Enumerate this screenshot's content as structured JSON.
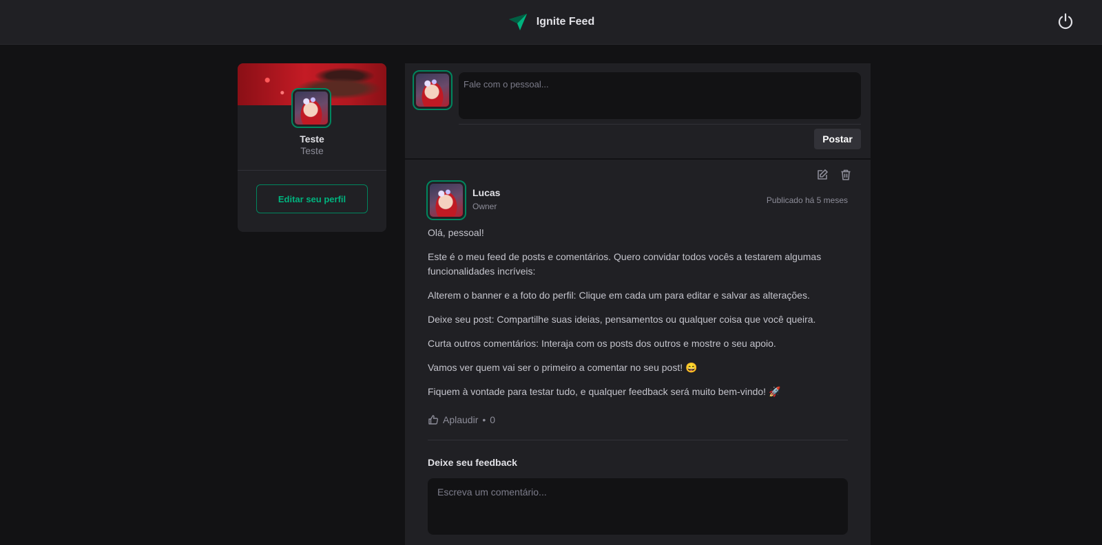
{
  "header": {
    "app_title": "Ignite Feed",
    "logo_icon": "paper-plane-icon",
    "logout_icon": "power-icon"
  },
  "sidebar": {
    "name": "Teste",
    "role": "Teste",
    "edit_label": "Editar seu perfil"
  },
  "composer": {
    "placeholder": "Fale com o pessoal...",
    "post_label": "Postar"
  },
  "post": {
    "author_name": "Lucas",
    "author_role": "Owner",
    "published": "Publicado há 5 meses",
    "paragraphs": [
      "Olá, pessoal!",
      "Este é o meu feed de posts e comentários. Quero convidar todos vocês a testarem algumas funcionalidades incríveis:",
      "Alterem o banner e a foto do perfil: Clique em cada um para editar e salvar as alterações.",
      "Deixe seu post: Compartilhe suas ideias, pensamentos ou qualquer coisa que você queira.",
      "Curta outros comentários: Interaja com os posts dos outros e mostre o seu apoio.",
      "Vamos ver quem vai ser o primeiro a comentar no seu post! 😄",
      "Fiquem à vontade para testar tudo, e qualquer feedback será muito bem-vindo! 🚀"
    ],
    "applaud_label": "Aplaudir",
    "applaud_separator": "•",
    "applaud_count": "0",
    "feedback_title": "Deixe seu feedback",
    "comment_placeholder": "Escreva um comentário..."
  },
  "colors": {
    "accent": "#00875f",
    "accent_light": "#00b37e",
    "background": "#121214",
    "surface": "#202024"
  }
}
